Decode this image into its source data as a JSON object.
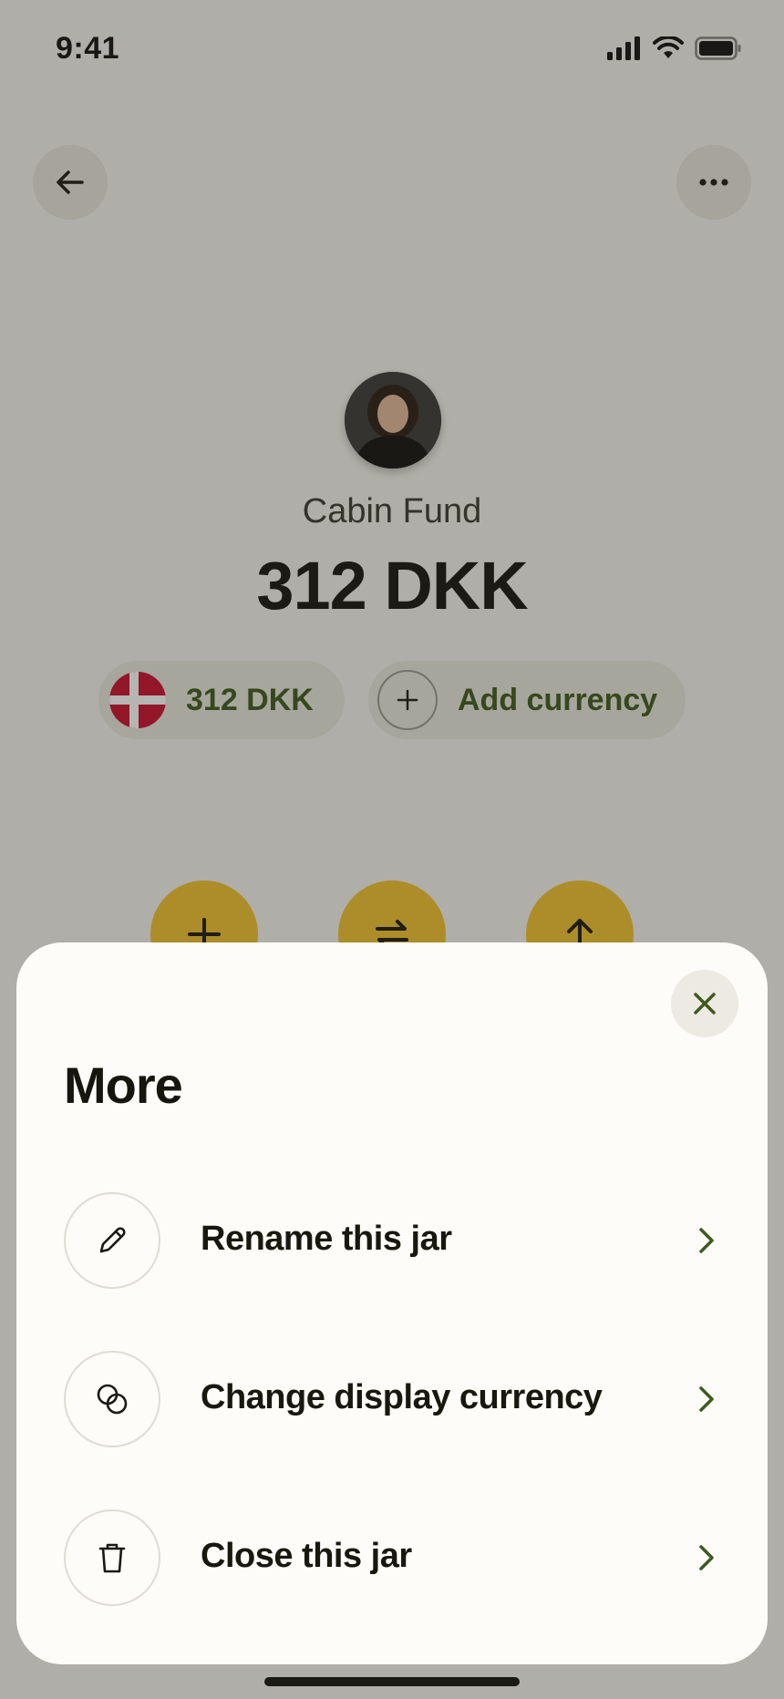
{
  "status_bar": {
    "time": "9:41"
  },
  "jar": {
    "name": "Cabin Fund",
    "balance": "312 DKK",
    "currency_pill": "312 DKK",
    "add_currency_label": "Add currency"
  },
  "sheet": {
    "title": "More",
    "items": [
      {
        "label": "Rename this jar",
        "icon": "pencil-icon"
      },
      {
        "label": "Change display currency",
        "icon": "currency-exchange-icon"
      },
      {
        "label": "Close this jar",
        "icon": "trash-icon"
      }
    ]
  },
  "colors": {
    "accent_green": "#3d5a1e",
    "action_yellow": "#f2c230",
    "sheet_background": "#fdfcf8"
  }
}
